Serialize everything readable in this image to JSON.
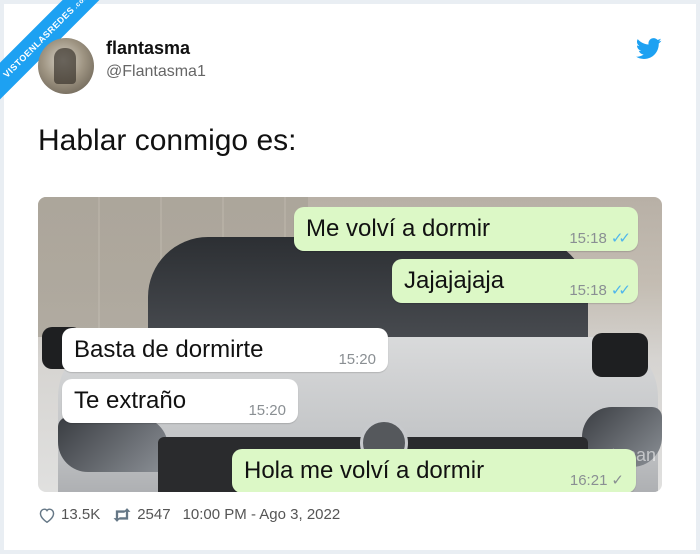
{
  "watermark": {
    "site": "VISTOENLASREDES",
    "suffix": ".com"
  },
  "user": {
    "name": "flantasma",
    "handle": "@Flantasma1"
  },
  "tweet": {
    "text": "Hablar conmigo es:"
  },
  "chat": {
    "messages": [
      {
        "text": "Me volví a dormir",
        "time": "15:18",
        "ticks": "✓✓"
      },
      {
        "text": "Jajajajaja",
        "time": "15:18",
        "ticks": "✓✓"
      },
      {
        "text": "Basta de dormirte",
        "time": "15:20"
      },
      {
        "text": "Te extraño",
        "time": "15:20"
      },
      {
        "text": "Hola me volví a dormir",
        "time": "16:21",
        "ticks": "✓"
      }
    ]
  },
  "photo_watermark": "mutanan",
  "stats": {
    "likes": "13.5K",
    "retweets": "2547",
    "timestamp": "10:00 PM - Ago 3, 2022"
  },
  "colors": {
    "twitter_blue": "#1da1f2",
    "bubble_out": "#dcf8c6",
    "bubble_in": "#ffffff",
    "read_tick": "#4fb6ec"
  }
}
